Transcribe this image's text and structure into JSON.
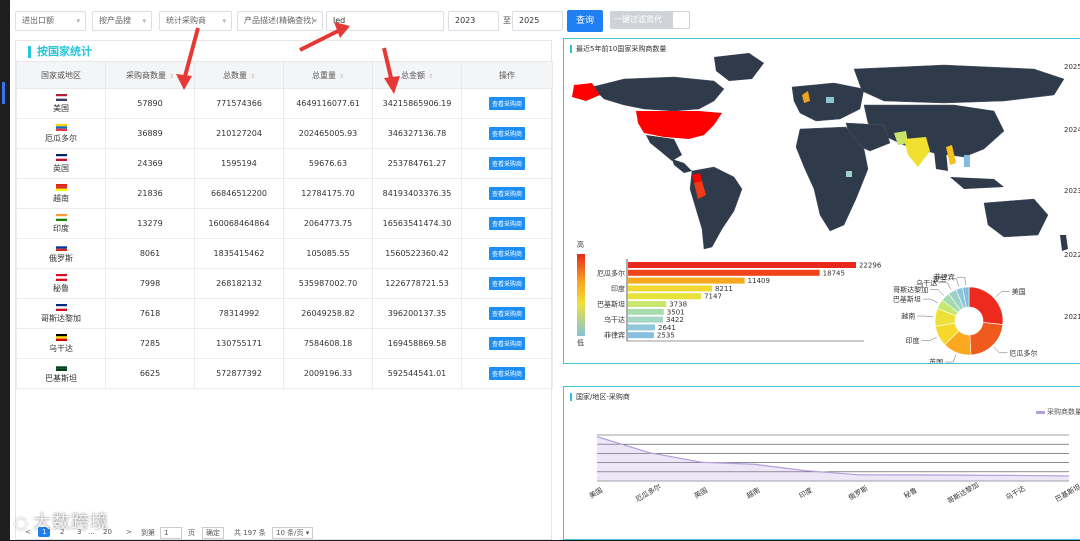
{
  "filters": {
    "direction": "进出口额",
    "dim": "按产品搜",
    "stat": "统计采购商",
    "product": "产品描述(精确查找)",
    "keyword": "led",
    "year_from": "2023",
    "to_label": "至",
    "year_to": "2025",
    "query_label": "查询",
    "filter_label": "一键过滤货代"
  },
  "section_title": "按国家统计",
  "table": {
    "headers": [
      "国家或地区",
      "采购商数量",
      "总数量",
      "总重量",
      "总金额",
      "操作"
    ],
    "action_label": "查看采购商",
    "rows": [
      {
        "country": "美国",
        "buyers": "57890",
        "qty": "771574366",
        "weight": "4649116077.61",
        "amount": "34215865906.19",
        "flag": [
          "#b22234",
          "#ffffff",
          "#3c3b6e"
        ]
      },
      {
        "country": "厄瓜多尔",
        "buyers": "36889",
        "qty": "210127204",
        "weight": "202465005.93",
        "amount": "346327136.78",
        "flag": [
          "#ffd100",
          "#0072ce",
          "#ef3340"
        ]
      },
      {
        "country": "英国",
        "buyers": "24369",
        "qty": "1595194",
        "weight": "59676.63",
        "amount": "253784761.27",
        "flag": [
          "#012169",
          "#ffffff",
          "#c8102e"
        ]
      },
      {
        "country": "越南",
        "buyers": "21836",
        "qty": "66846512200",
        "weight": "12784175.70",
        "amount": "84193403376.35",
        "flag": [
          "#da251d",
          "#da251d",
          "#ffff00"
        ]
      },
      {
        "country": "印度",
        "buyers": "13279",
        "qty": "160068464864",
        "weight": "2064773.75",
        "amount": "16563541474.30",
        "flag": [
          "#ff9933",
          "#ffffff",
          "#138808"
        ]
      },
      {
        "country": "俄罗斯",
        "buyers": "8061",
        "qty": "1835415462",
        "weight": "105085.55",
        "amount": "1560522360.42",
        "flag": [
          "#ffffff",
          "#0039a6",
          "#d52b1e"
        ]
      },
      {
        "country": "秘鲁",
        "buyers": "7998",
        "qty": "268182132",
        "weight": "535987002.70",
        "amount": "1226778721.53",
        "flag": [
          "#d91023",
          "#ffffff",
          "#d91023"
        ]
      },
      {
        "country": "哥斯达黎加",
        "buyers": "7618",
        "qty": "78314992",
        "weight": "26049258.82",
        "amount": "396200137.35",
        "flag": [
          "#002b7f",
          "#ffffff",
          "#ce1126"
        ]
      },
      {
        "country": "乌干达",
        "buyers": "7285",
        "qty": "130755171",
        "weight": "7584608.18",
        "amount": "169458869.58",
        "flag": [
          "#000000",
          "#fcdc04",
          "#d90000"
        ]
      },
      {
        "country": "巴基斯坦",
        "buyers": "6625",
        "qty": "572877392",
        "weight": "2009196.33",
        "amount": "592544541.01",
        "flag": [
          "#ffffff",
          "#01411c",
          "#01411c"
        ]
      }
    ]
  },
  "pager": {
    "prev": "<",
    "p1": "1",
    "p2": "2",
    "p3": "3",
    "ellipsis": "...",
    "plast": "20",
    "next": ">",
    "goto": "到第",
    "goto_val": "1",
    "page_unit": "页",
    "confirm": "确定",
    "total": "共 197 条",
    "size": "10 条/页"
  },
  "watermark": "大数跨境",
  "panel1_title": "最近5年前10国家采购商数量",
  "panel2_title": "国家/地区-采购商",
  "map_legend": {
    "high": "高",
    "low": "低"
  },
  "years": [
    "2025",
    "2024",
    "2023",
    "2022",
    "2021"
  ],
  "colors": {
    "accent": "#26c6da",
    "primary": "#1e7ef2",
    "ocean": "#ffffff",
    "land": "#2f3a4a"
  },
  "chart_data": [
    {
      "type": "bar",
      "orientation": "horizontal",
      "categories": [
        "",
        "厄瓜多尔",
        "",
        "印度",
        "",
        "巴基斯坦",
        "",
        "乌干达",
        "",
        "菲律宾"
      ],
      "values": [
        22296,
        18745,
        11409,
        8211,
        7147,
        3738,
        3501,
        3422,
        2641,
        2535
      ],
      "colors": [
        "#e8281e",
        "#f0451b",
        "#f8a81f",
        "#f1d830",
        "#e9e238",
        "#c9e76e",
        "#a8dcaf",
        "#a6d6c5",
        "#8fc7d8",
        "#87bfe0"
      ]
    },
    {
      "type": "pie",
      "labels": [
        "美国",
        "厄瓜多尔",
        "英国",
        "印度",
        "越南",
        "巴基斯坦",
        "哥斯达黎加",
        "乌干达",
        "波兰",
        "菲律宾"
      ],
      "values": [
        22296,
        18745,
        11409,
        8211,
        7147,
        3738,
        3501,
        3422,
        2641,
        2535
      ],
      "colors": [
        "#ee2a1f",
        "#f05a1c",
        "#fba81e",
        "#f6d82d",
        "#eee03a",
        "#c6e86e",
        "#a4dcae",
        "#9ed2c8",
        "#8cc6d8",
        "#84bce1"
      ]
    },
    {
      "type": "line",
      "series": [
        {
          "name": "采购商数量",
          "values": [
            57890,
            36889,
            24369,
            21836,
            13279,
            8061,
            7998,
            7618,
            7285,
            6625
          ]
        }
      ],
      "categories": [
        "美国",
        "厄瓜多尔",
        "英国",
        "越南",
        "印度",
        "俄罗斯",
        "秘鲁",
        "哥斯达黎加",
        "乌干达",
        "巴基斯坦"
      ],
      "ylim": [
        0,
        60000
      ]
    }
  ]
}
